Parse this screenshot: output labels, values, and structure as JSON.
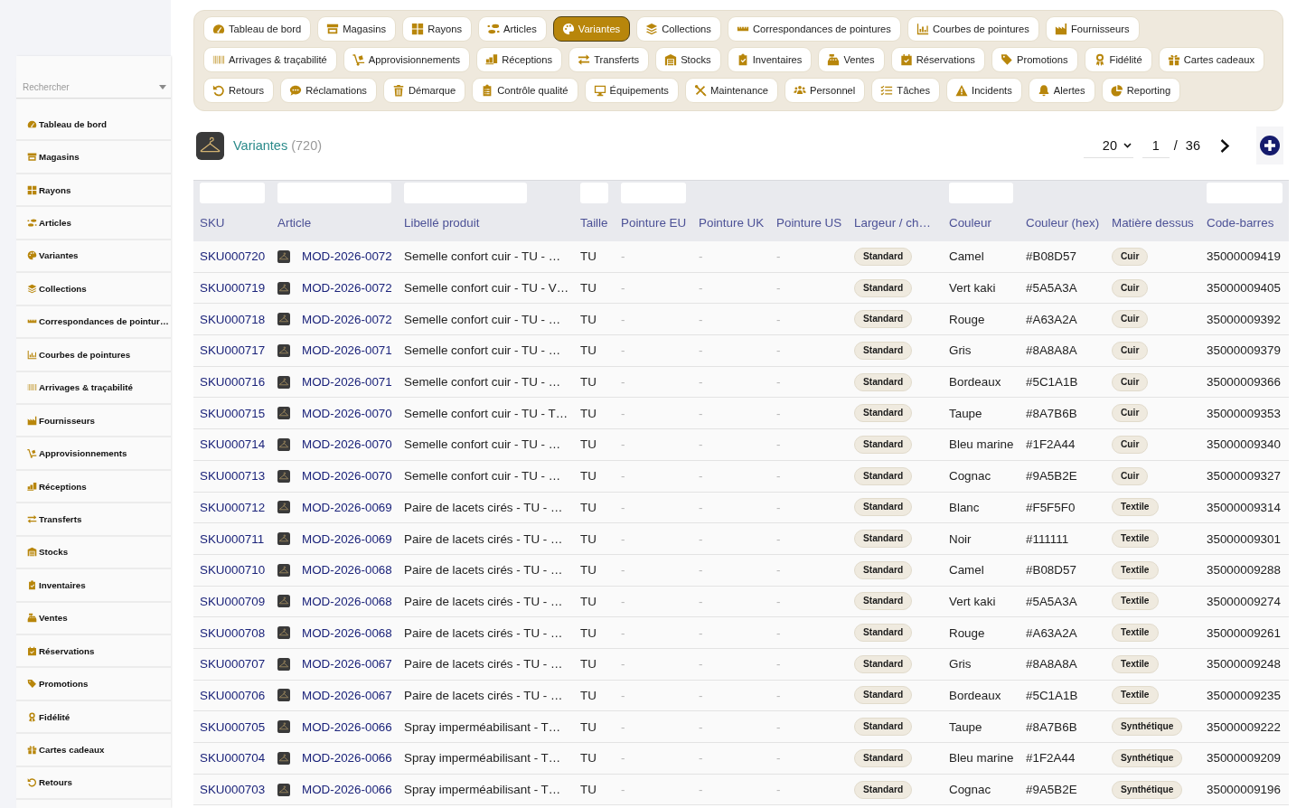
{
  "sidebar": {
    "search": {
      "placeholder": "Rechercher"
    },
    "items": [
      "Tableau de bord",
      "Magasins",
      "Rayons",
      "Articles",
      "Variantes",
      "Collections",
      "Correspondances de pointur…",
      "Courbes de pointures",
      "Arrivages & traçabilité",
      "Fournisseurs",
      "Approvisionnements",
      "Réceptions",
      "Transferts",
      "Stocks",
      "Inventaires",
      "Ventes",
      "Réservations",
      "Promotions",
      "Fidélité",
      "Cartes cadeaux",
      "Retours"
    ]
  },
  "nav_tabs": [
    {
      "label": "Tableau de bord",
      "selected": false
    },
    {
      "label": "Magasins",
      "selected": false
    },
    {
      "label": "Rayons",
      "selected": false
    },
    {
      "label": "Articles",
      "selected": false
    },
    {
      "label": "Variantes",
      "selected": true
    },
    {
      "label": "Collections",
      "selected": false
    },
    {
      "label": "Correspondances de pointures",
      "selected": false
    },
    {
      "label": "Courbes de pointures",
      "selected": false
    },
    {
      "label": "Fournisseurs",
      "selected": false
    },
    {
      "label": "Arrivages & traçabilité",
      "selected": false
    },
    {
      "label": "Approvisionnements",
      "selected": false
    },
    {
      "label": "Réceptions",
      "selected": false
    },
    {
      "label": "Transferts",
      "selected": false
    },
    {
      "label": "Stocks",
      "selected": false
    },
    {
      "label": "Inventaires",
      "selected": false
    },
    {
      "label": "Ventes",
      "selected": false
    },
    {
      "label": "Réservations",
      "selected": false
    },
    {
      "label": "Promotions",
      "selected": false
    },
    {
      "label": "Fidélité",
      "selected": false
    },
    {
      "label": "Cartes cadeaux",
      "selected": false
    },
    {
      "label": "Retours",
      "selected": false
    },
    {
      "label": "Réclamations",
      "selected": false
    },
    {
      "label": "Démarque",
      "selected": false
    },
    {
      "label": "Contrôle qualité",
      "selected": false
    },
    {
      "label": "Équipements",
      "selected": false
    },
    {
      "label": "Maintenance",
      "selected": false
    },
    {
      "label": "Personnel",
      "selected": false
    },
    {
      "label": "Tâches",
      "selected": false
    },
    {
      "label": "Incidents",
      "selected": false
    },
    {
      "label": "Alertes",
      "selected": false
    },
    {
      "label": "Reporting",
      "selected": false
    }
  ],
  "header": {
    "title": "Variantes",
    "count": "(720)"
  },
  "pagination": {
    "page_size": "20",
    "page": "1",
    "separator": "/",
    "total_pages": "36"
  },
  "table": {
    "columns": [
      {
        "label": "SKU",
        "kind": "link",
        "filter": true
      },
      {
        "label": "Article",
        "kind": "article",
        "filter": true
      },
      {
        "label": "Libellé produit",
        "kind": "text",
        "filter": true
      },
      {
        "label": "Taille",
        "kind": "text",
        "filter": true
      },
      {
        "label": "Pointure EU",
        "kind": "muted",
        "filter": true
      },
      {
        "label": "Pointure UK",
        "kind": "muted",
        "filter": false
      },
      {
        "label": "Pointure US",
        "kind": "muted",
        "filter": false
      },
      {
        "label": "Largeur / ch…",
        "kind": "badge",
        "filter": false
      },
      {
        "label": "Couleur",
        "kind": "text",
        "filter": true
      },
      {
        "label": "Couleur (hex)",
        "kind": "text",
        "filter": false
      },
      {
        "label": "Matière dessus",
        "kind": "badge",
        "filter": false
      },
      {
        "label": "Code-barres",
        "kind": "text",
        "filter": true
      }
    ],
    "rows": [
      [
        "SKU000720",
        "MOD-2026-0072",
        "Semelle confort cuir - TU - …",
        "TU",
        "-",
        "-",
        "-",
        "Standard",
        "Camel",
        "#B08D57",
        "Cuir",
        "35000009419"
      ],
      [
        "SKU000719",
        "MOD-2026-0072",
        "Semelle confort cuir - TU - V…",
        "TU",
        "-",
        "-",
        "-",
        "Standard",
        "Vert kaki",
        "#5A5A3A",
        "Cuir",
        "35000009405"
      ],
      [
        "SKU000718",
        "MOD-2026-0072",
        "Semelle confort cuir - TU - …",
        "TU",
        "-",
        "-",
        "-",
        "Standard",
        "Rouge",
        "#A63A2A",
        "Cuir",
        "35000009392"
      ],
      [
        "SKU000717",
        "MOD-2026-0071",
        "Semelle confort cuir - TU - …",
        "TU",
        "-",
        "-",
        "-",
        "Standard",
        "Gris",
        "#8A8A8A",
        "Cuir",
        "35000009379"
      ],
      [
        "SKU000716",
        "MOD-2026-0071",
        "Semelle confort cuir - TU - …",
        "TU",
        "-",
        "-",
        "-",
        "Standard",
        "Bordeaux",
        "#5C1A1B",
        "Cuir",
        "35000009366"
      ],
      [
        "SKU000715",
        "MOD-2026-0070",
        "Semelle confort cuir - TU - T…",
        "TU",
        "-",
        "-",
        "-",
        "Standard",
        "Taupe",
        "#8A7B6B",
        "Cuir",
        "35000009353"
      ],
      [
        "SKU000714",
        "MOD-2026-0070",
        "Semelle confort cuir - TU - …",
        "TU",
        "-",
        "-",
        "-",
        "Standard",
        "Bleu marine",
        "#1F2A44",
        "Cuir",
        "35000009340"
      ],
      [
        "SKU000713",
        "MOD-2026-0070",
        "Semelle confort cuir - TU - …",
        "TU",
        "-",
        "-",
        "-",
        "Standard",
        "Cognac",
        "#9A5B2E",
        "Cuir",
        "35000009327"
      ],
      [
        "SKU000712",
        "MOD-2026-0069",
        "Paire de lacets cirés - TU - …",
        "TU",
        "-",
        "-",
        "-",
        "Standard",
        "Blanc",
        "#F5F5F0",
        "Textile",
        "35000009314"
      ],
      [
        "SKU000711",
        "MOD-2026-0069",
        "Paire de lacets cirés - TU - …",
        "TU",
        "-",
        "-",
        "-",
        "Standard",
        "Noir",
        "#111111",
        "Textile",
        "35000009301"
      ],
      [
        "SKU000710",
        "MOD-2026-0068",
        "Paire de lacets cirés - TU - …",
        "TU",
        "-",
        "-",
        "-",
        "Standard",
        "Camel",
        "#B08D57",
        "Textile",
        "35000009288"
      ],
      [
        "SKU000709",
        "MOD-2026-0068",
        "Paire de lacets cirés - TU - …",
        "TU",
        "-",
        "-",
        "-",
        "Standard",
        "Vert kaki",
        "#5A5A3A",
        "Textile",
        "35000009274"
      ],
      [
        "SKU000708",
        "MOD-2026-0068",
        "Paire de lacets cirés - TU - …",
        "TU",
        "-",
        "-",
        "-",
        "Standard",
        "Rouge",
        "#A63A2A",
        "Textile",
        "35000009261"
      ],
      [
        "SKU000707",
        "MOD-2026-0067",
        "Paire de lacets cirés - TU - …",
        "TU",
        "-",
        "-",
        "-",
        "Standard",
        "Gris",
        "#8A8A8A",
        "Textile",
        "35000009248"
      ],
      [
        "SKU000706",
        "MOD-2026-0067",
        "Paire de lacets cirés - TU - …",
        "TU",
        "-",
        "-",
        "-",
        "Standard",
        "Bordeaux",
        "#5C1A1B",
        "Textile",
        "35000009235"
      ],
      [
        "SKU000705",
        "MOD-2026-0066",
        "Spray imperméabilisant - T…",
        "TU",
        "-",
        "-",
        "-",
        "Standard",
        "Taupe",
        "#8A7B6B",
        "Synthétique",
        "35000009222"
      ],
      [
        "SKU000704",
        "MOD-2026-0066",
        "Spray imperméabilisant - T…",
        "TU",
        "-",
        "-",
        "-",
        "Standard",
        "Bleu marine",
        "#1F2A44",
        "Synthétique",
        "35000009209"
      ],
      [
        "SKU000703",
        "MOD-2026-0066",
        "Spray imperméabilisant - T…",
        "TU",
        "-",
        "-",
        "-",
        "Standard",
        "Cognac",
        "#9A5B2E",
        "Synthétique",
        "35000009196"
      ]
    ]
  }
}
